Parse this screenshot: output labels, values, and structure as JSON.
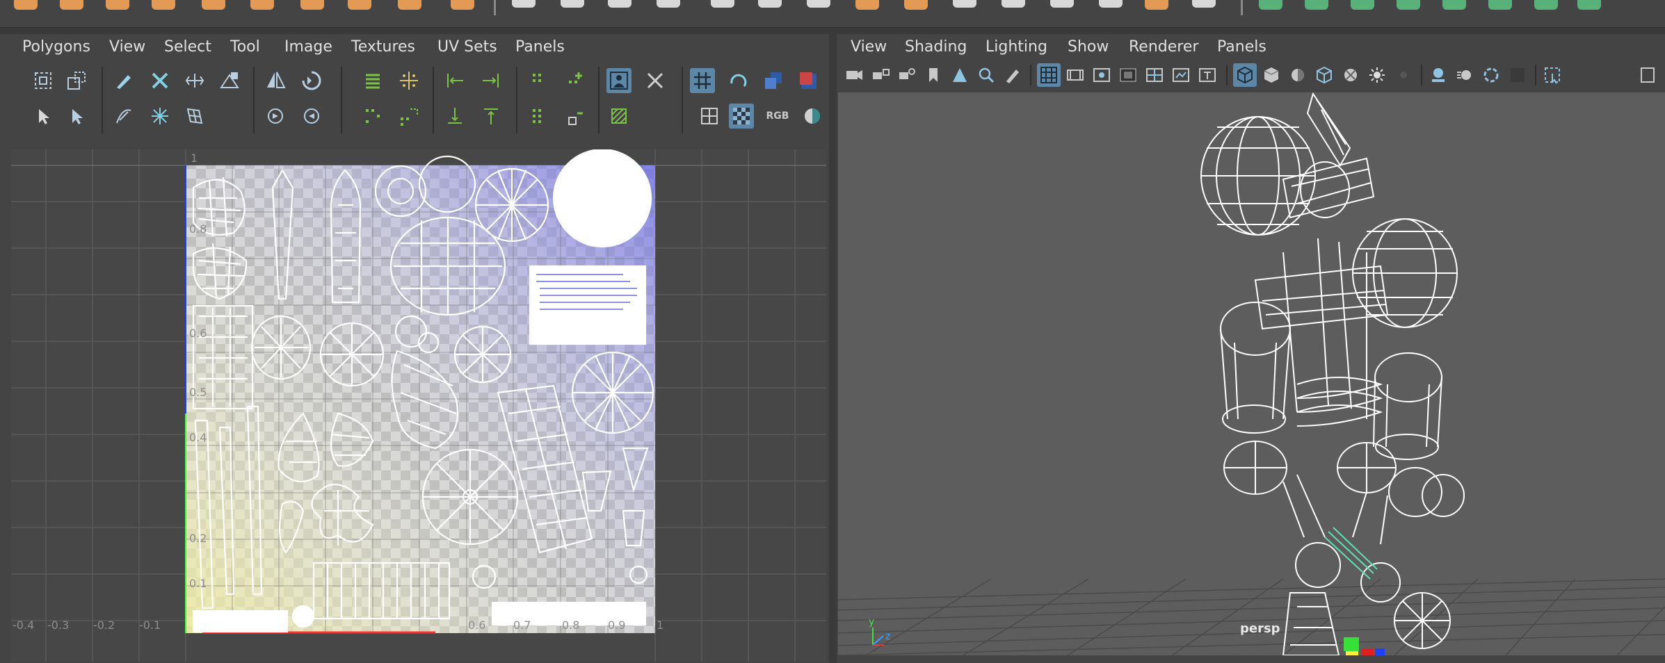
{
  "uv_editor": {
    "menu": [
      "Polygons",
      "View",
      "Select",
      "Tool",
      "Image",
      "Textures",
      "UV Sets",
      "Panels"
    ],
    "rgb_label": "RGB",
    "axis_top_label": "1",
    "v_axis_labels": [
      "0.8",
      "0.6",
      "0.5",
      "0.4",
      "0.2",
      "0.1"
    ],
    "u_axis_labels": [
      "-0.4",
      "-0.3",
      "-0.2",
      "-0.1",
      "0.6",
      "0.7",
      "0.8",
      "0.9",
      "1"
    ]
  },
  "viewport": {
    "menu": [
      "View",
      "Shading",
      "Lighting",
      "Show",
      "Renderer",
      "Panels"
    ],
    "camera_label": "persp",
    "axis_labels": {
      "y": "y",
      "z": "z"
    }
  },
  "colors": {
    "shelf_orange": "#e29a55",
    "shelf_green": "#59b17a",
    "active_tool": "#5d87a6",
    "uv_tile_blue": "#8c8cd8",
    "uv_tile_yellow": "#e7e6a4",
    "wireframe": "#ffffff"
  }
}
